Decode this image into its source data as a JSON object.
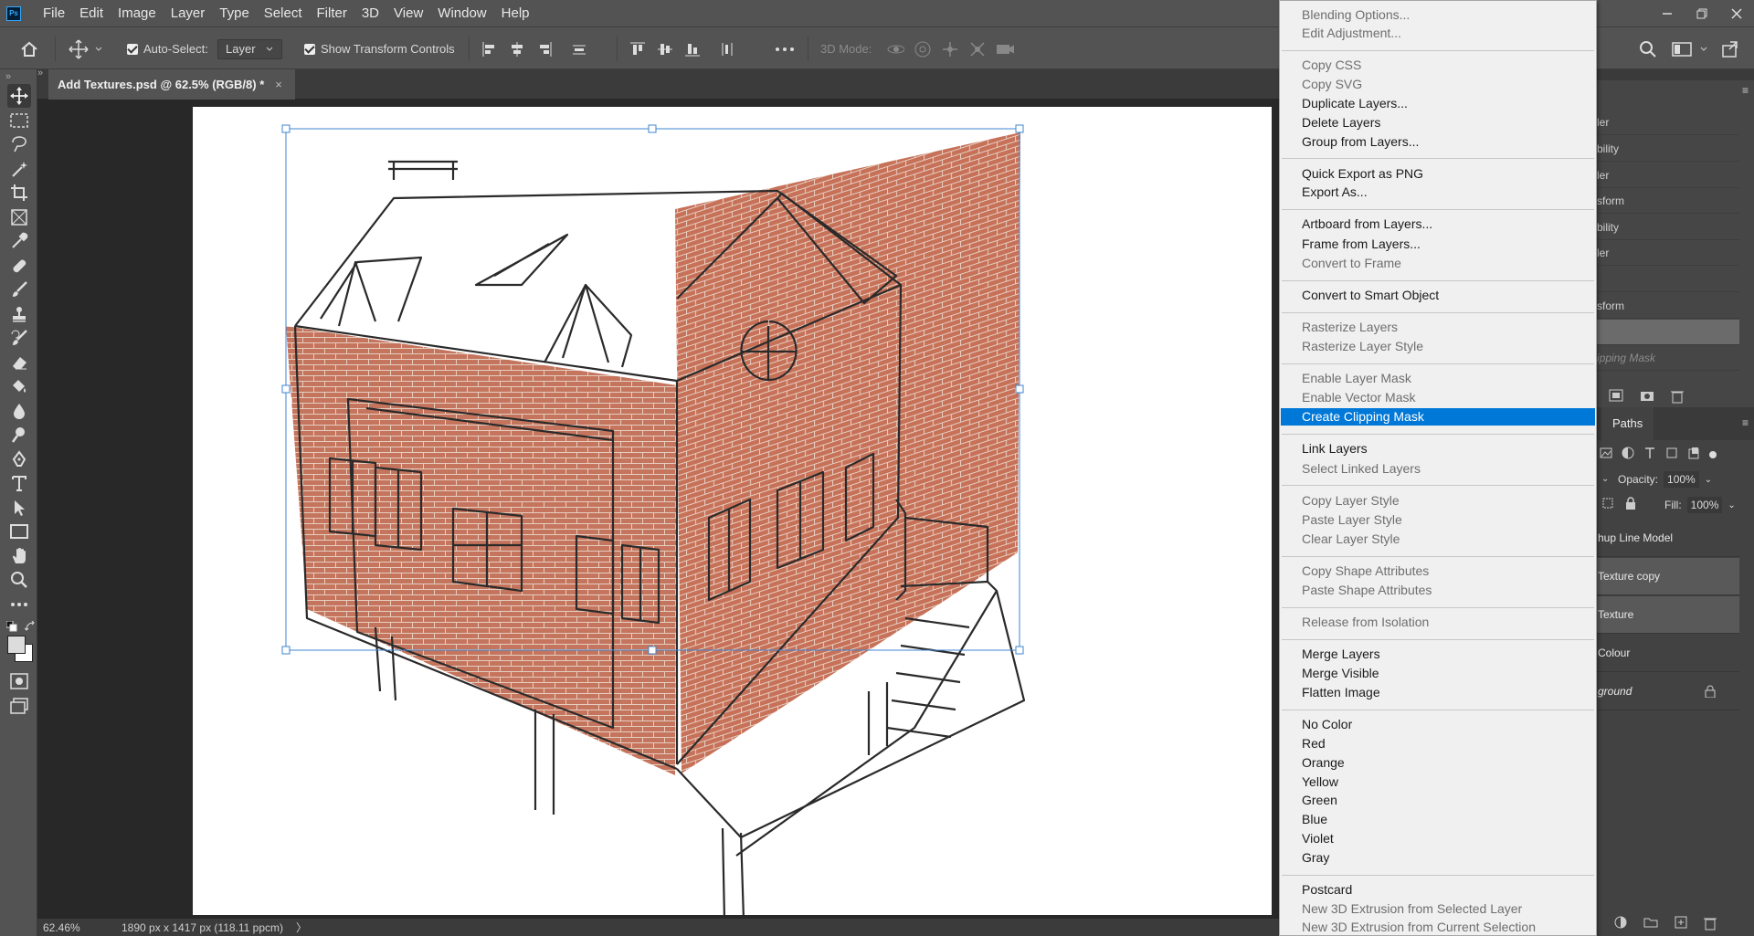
{
  "menubar": {
    "logo": "Ps",
    "items": [
      "File",
      "Edit",
      "Image",
      "Layer",
      "Type",
      "Select",
      "Filter",
      "3D",
      "View",
      "Window",
      "Help"
    ]
  },
  "options_bar": {
    "auto_select_label": "Auto-Select:",
    "auto_select_value": "Layer",
    "show_transform_label": "Show Transform Controls",
    "mode_3d_label": "3D Mode:"
  },
  "document": {
    "tab_title": "Add Textures.psd @ 62.5% (RGB/8) *",
    "close_glyph": "×"
  },
  "status_bar": {
    "zoom": "62.46%",
    "doc_size": "1890 px x 1417 px (118.11 ppcm)",
    "arrow": "〉"
  },
  "history_panel": {
    "rows": [
      "ler",
      "bility",
      "ler",
      "sform",
      "bility",
      "ler",
      "",
      "sform",
      "",
      "ipping Mask"
    ]
  },
  "layers_panel": {
    "tab_paths": "Paths",
    "opacity_label": "Opacity:",
    "opacity_value": "100%",
    "fill_label": "Fill:",
    "fill_value": "100%",
    "layers": [
      {
        "name": "hup Line Model"
      },
      {
        "name": "Texture copy"
      },
      {
        "name": "Texture"
      },
      {
        "name": "Colour"
      },
      {
        "name": "ground"
      }
    ]
  },
  "context_menu": {
    "items": [
      {
        "label": "Blending Options...",
        "disabled": true
      },
      {
        "label": "Edit Adjustment...",
        "disabled": true
      },
      {
        "label": "Copy CSS",
        "disabled": true
      },
      {
        "label": "Copy SVG",
        "disabled": true
      },
      {
        "label": "Duplicate Layers...",
        "disabled": false
      },
      {
        "label": "Delete Layers",
        "disabled": false
      },
      {
        "label": "Group from Layers...",
        "disabled": false
      },
      {
        "label": "Quick Export as PNG",
        "disabled": false
      },
      {
        "label": "Export As...",
        "disabled": false
      },
      {
        "label": "Artboard from Layers...",
        "disabled": false
      },
      {
        "label": "Frame from Layers...",
        "disabled": false
      },
      {
        "label": "Convert to Frame",
        "disabled": true
      },
      {
        "label": "Convert to Smart Object",
        "disabled": false
      },
      {
        "label": "Rasterize Layers",
        "disabled": true
      },
      {
        "label": "Rasterize Layer Style",
        "disabled": true
      },
      {
        "label": "Enable Layer Mask",
        "disabled": true
      },
      {
        "label": "Enable Vector Mask",
        "disabled": true
      },
      {
        "label": "Create Clipping Mask",
        "disabled": false,
        "highlighted": true
      },
      {
        "label": "Link Layers",
        "disabled": false
      },
      {
        "label": "Select Linked Layers",
        "disabled": true
      },
      {
        "label": "Copy Layer Style",
        "disabled": true
      },
      {
        "label": "Paste Layer Style",
        "disabled": true
      },
      {
        "label": "Clear Layer Style",
        "disabled": true
      },
      {
        "label": "Copy Shape Attributes",
        "disabled": true
      },
      {
        "label": "Paste Shape Attributes",
        "disabled": true
      },
      {
        "label": "Release from Isolation",
        "disabled": true
      },
      {
        "label": "Merge Layers",
        "disabled": false
      },
      {
        "label": "Merge Visible",
        "disabled": false
      },
      {
        "label": "Flatten Image",
        "disabled": false
      },
      {
        "label": "No Color",
        "disabled": false
      },
      {
        "label": "Red",
        "disabled": false
      },
      {
        "label": "Orange",
        "disabled": false
      },
      {
        "label": "Yellow",
        "disabled": false
      },
      {
        "label": "Green",
        "disabled": false
      },
      {
        "label": "Blue",
        "disabled": false
      },
      {
        "label": "Violet",
        "disabled": false
      },
      {
        "label": "Gray",
        "disabled": false
      },
      {
        "label": "Postcard",
        "disabled": false
      },
      {
        "label": "New 3D Extrusion from Selected Layer",
        "disabled": true
      },
      {
        "label": "New 3D Extrusion from Current Selection",
        "disabled": true
      }
    ]
  },
  "colors": {
    "highlight": "#0078d7",
    "brick": "#c0684f",
    "ui_dark": "#535353"
  }
}
